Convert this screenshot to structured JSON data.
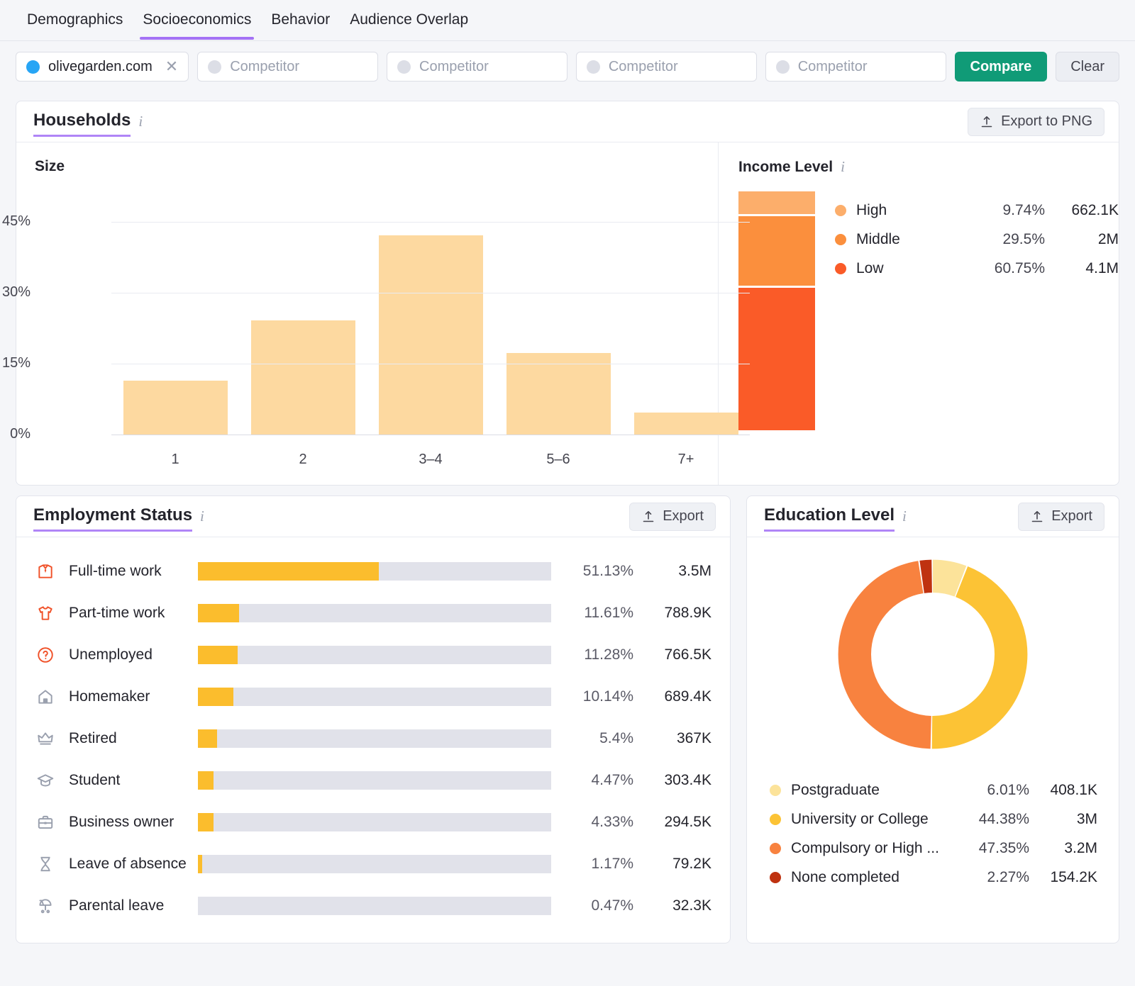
{
  "tabs": [
    {
      "label": "Demographics",
      "active": false
    },
    {
      "label": "Socioeconomics",
      "active": true
    },
    {
      "label": "Behavior",
      "active": false
    },
    {
      "label": "Audience Overlap",
      "active": false
    }
  ],
  "competitors": {
    "primary": {
      "label": "olivegarden.com",
      "dot_color": "#27a5f5",
      "close_glyph": "✕"
    },
    "placeholders": [
      "Competitor",
      "Competitor",
      "Competitor",
      "Competitor"
    ],
    "compare_label": "Compare",
    "clear_label": "Clear",
    "compare_color": "#109b77"
  },
  "households": {
    "title": "Households",
    "export_label": "Export to PNG",
    "size_title": "Size",
    "income_title": "Income Level"
  },
  "employment": {
    "title": "Employment Status",
    "export_label": "Export",
    "rows": [
      {
        "icon": "shirt-tie-icon",
        "label": "Full-time work",
        "pct": "51.13%",
        "value": "3.5M",
        "fill": 51.13,
        "icon_color": "#f0522a"
      },
      {
        "icon": "tshirt-icon",
        "label": "Part-time work",
        "pct": "11.61%",
        "value": "788.9K",
        "fill": 11.61,
        "icon_color": "#f0522a"
      },
      {
        "icon": "question-circle-icon",
        "label": "Unemployed",
        "pct": "11.28%",
        "value": "766.5K",
        "fill": 11.28,
        "icon_color": "#f0522a"
      },
      {
        "icon": "house-icon",
        "label": "Homemaker",
        "pct": "10.14%",
        "value": "689.4K",
        "fill": 10.14,
        "icon_color": "#9aa0ae"
      },
      {
        "icon": "crown-icon",
        "label": "Retired",
        "pct": "5.4%",
        "value": "367K",
        "fill": 5.4,
        "icon_color": "#9aa0ae"
      },
      {
        "icon": "graduation-cap-icon",
        "label": "Student",
        "pct": "4.47%",
        "value": "303.4K",
        "fill": 4.47,
        "icon_color": "#9aa0ae"
      },
      {
        "icon": "briefcase-icon",
        "label": "Business owner",
        "pct": "4.33%",
        "value": "294.5K",
        "fill": 4.33,
        "icon_color": "#9aa0ae"
      },
      {
        "icon": "hourglass-icon",
        "label": "Leave of absence",
        "pct": "1.17%",
        "value": "79.2K",
        "fill": 1.17,
        "icon_color": "#9aa0ae"
      },
      {
        "icon": "stroller-icon",
        "label": "Parental leave",
        "pct": "0.47%",
        "value": "32.3K",
        "fill": 0,
        "icon_color": "#9aa0ae"
      }
    ],
    "fill_color": "#fbbd2d",
    "track_color": "#e1e2ea"
  },
  "education": {
    "title": "Education Level",
    "export_label": "Export"
  },
  "chart_data": [
    {
      "type": "bar",
      "title": "Size",
      "categories": [
        "1",
        "2",
        "3–4",
        "5–6",
        "7+"
      ],
      "values": [
        11.4,
        24.2,
        42.2,
        17.2,
        4.6
      ],
      "ytick_labels": [
        "45%",
        "30%",
        "15%",
        "0%"
      ],
      "ytick_values": [
        45,
        30,
        15,
        0
      ],
      "ylim": [
        0,
        48
      ],
      "xlabel": "",
      "ylabel": "",
      "grid": true,
      "bar_color": "#fdd9a0",
      "legend": "none"
    },
    {
      "type": "stacked-bar",
      "title": "Income Level",
      "categories": [
        "High",
        "Middle",
        "Low"
      ],
      "values": [
        9.74,
        29.5,
        60.75
      ],
      "pct_labels": [
        "9.74%",
        "29.5%",
        "60.75%"
      ],
      "count_labels": [
        "662.1K",
        "2M",
        "4.1M"
      ],
      "colors": [
        "#fcae6b",
        "#fb8f3d",
        "#fa5b28"
      ],
      "legend": "right"
    },
    {
      "type": "pie",
      "title": "Education Level",
      "categories": [
        "Postgraduate",
        "University or College",
        "Compulsory or High ...",
        "None completed"
      ],
      "values": [
        6.01,
        44.38,
        47.35,
        2.27
      ],
      "pct_labels": [
        "6.01%",
        "44.38%",
        "47.35%",
        "2.27%"
      ],
      "count_labels": [
        "408.1K",
        "3M",
        "3.2M",
        "154.2K"
      ],
      "colors": [
        "#fce39a",
        "#fcc335",
        "#f8823f",
        "#bf3210"
      ],
      "donut": true,
      "legend": "bottom"
    }
  ]
}
